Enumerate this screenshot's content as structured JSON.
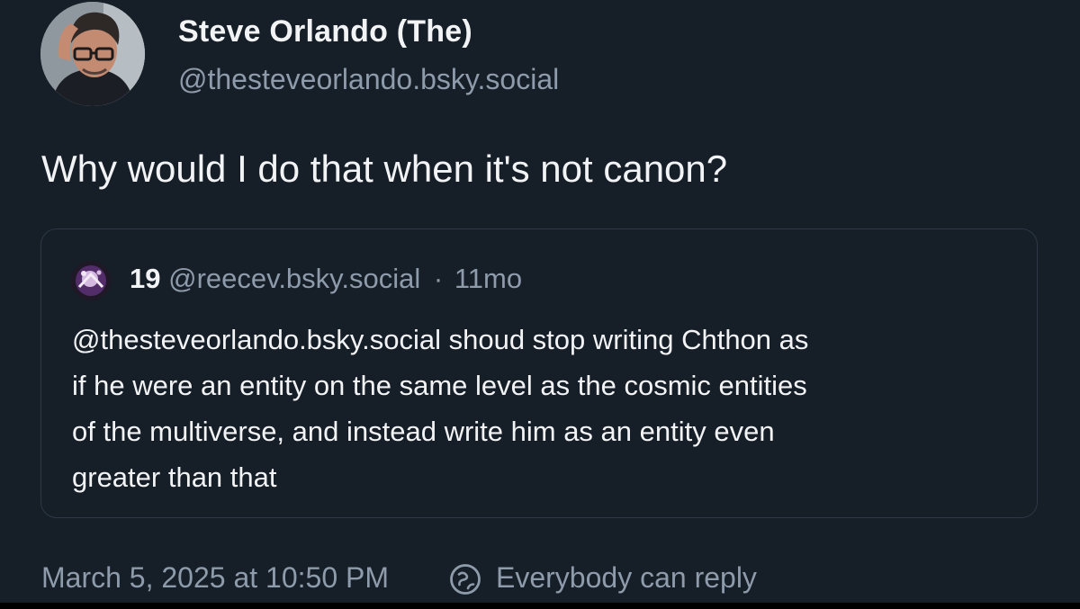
{
  "author": {
    "name": "Steve Orlando (The)",
    "handle": "@thesteveorlando.bsky.social",
    "avatar_icon": "person-photo-avatar"
  },
  "post": {
    "text": "Why would I do that when it's not canon?"
  },
  "quote": {
    "name": "19",
    "handle": "@reecev.bsky.social",
    "separator": "·",
    "age": "11mo",
    "avatar_icon": "dark-purple-avatar",
    "text_lines": [
      "@thesteveorlando.bsky.social shoud stop writing Chthon as",
      "if he were an entity on the same level as the cosmic entities",
      "of the multiverse, and instead write him as an entity even",
      "greater than that"
    ]
  },
  "footer": {
    "timestamp": "March 5, 2025 at 10:50 PM",
    "reply_icon": "globe-reply-icon",
    "reply_setting": "Everybody can reply"
  },
  "colors": {
    "background": "#161e27",
    "primary_text": "#f1f3f5",
    "secondary_text": "#8e9bab",
    "border": "#2d3947"
  }
}
